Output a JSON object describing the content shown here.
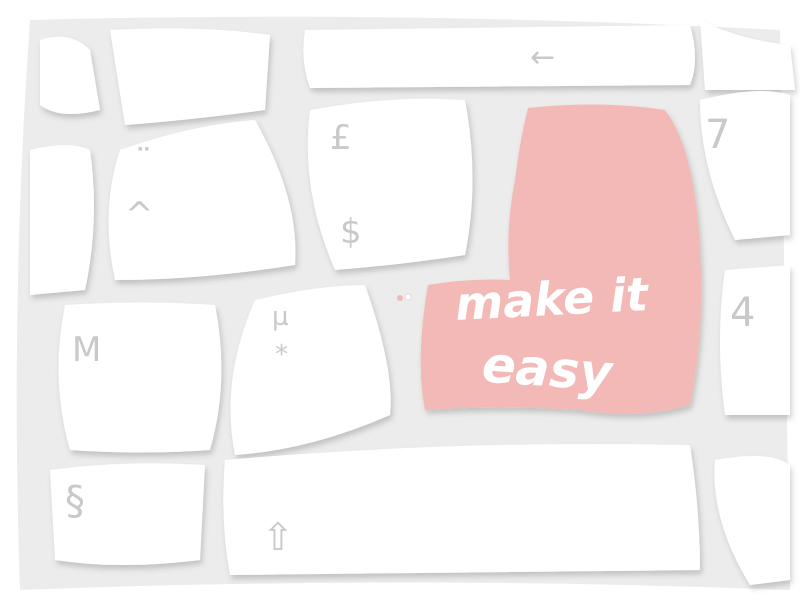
{
  "image": {
    "subject": "keyboard",
    "accent_color": "#f2b9b6",
    "key_color": "#ffffff",
    "gap_color": "#ececec"
  },
  "highlight_key": {
    "line1": "make it",
    "line2": "easy"
  },
  "keys": [
    {
      "top": "¨",
      "bottom": "^"
    },
    {
      "top": "£",
      "bottom": "$"
    },
    {
      "top": "M"
    },
    {
      "top": "µ",
      "bottom": "*"
    },
    {
      "top": "7"
    },
    {
      "top": "4"
    },
    {
      "top": "§"
    },
    {
      "top": "⇧"
    },
    {
      "top": "←"
    }
  ]
}
